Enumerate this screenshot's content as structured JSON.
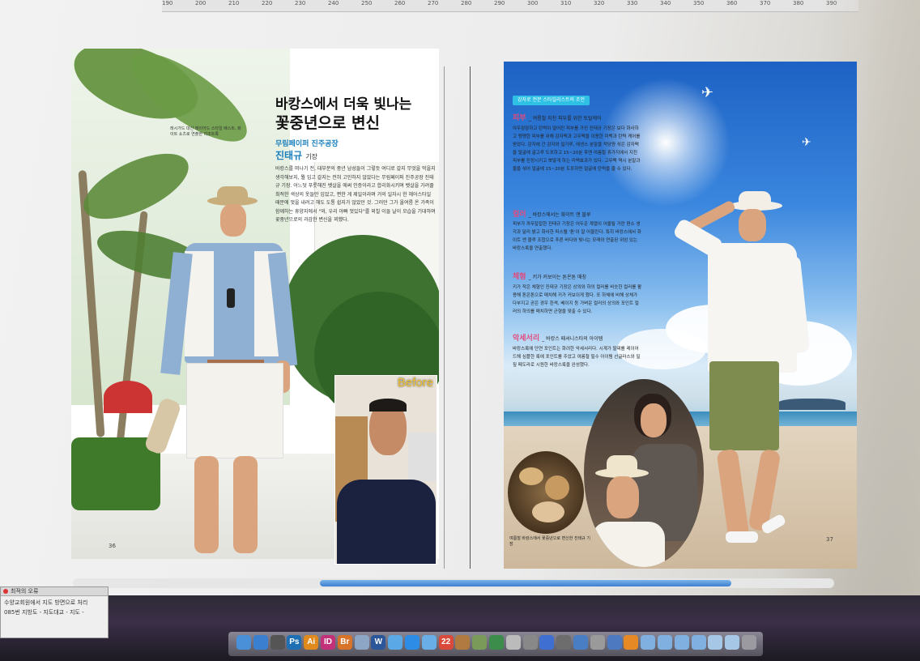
{
  "ruler": {
    "ticks": [
      "190",
      "200",
      "210",
      "220",
      "230",
      "240",
      "250",
      "260",
      "270",
      "280",
      "290",
      "300",
      "310",
      "320",
      "330",
      "340",
      "350",
      "360",
      "370",
      "380",
      "390"
    ]
  },
  "left_page": {
    "headline_line1": "바캉스에서 더욱 빛나는",
    "headline_line2": "꽃중년으로 변신",
    "byline_sub": "무림페이퍼 진주공장",
    "byline_name": "진태규",
    "byline_title": "기장",
    "body": "바캉스를 떠나기 전, 대부분의 중년 남성들이 그렇듯 여디로 갈지 무엇을 먹을지 생각해보지, 뭘 입고 갈지는 전혀 고민하지 않았다는 무림페이퍼 진주공장 진태규 기장. 어느덧 푸릇해진 뱃살을 에써 인증이라고 합리화시키며 뱃살을 가려줄 최적한 색상의 옷들만 입었고, 편한 게 제일이라며 거의 일자시 한 헤어스타일 때문에 멋을 내려고 해도 도통 쉽지가 않았던 것. 그러던 그가 올여름 온 가족이 함께하는 휴양지에서 \"와, 우리 아빠 멋있다\"를 외칠 이들 날이 모습을 기대하며 꽃중년으로의 과감한 변신을 꾀했다.",
    "caption": "래시가드 대신 레이어드 스타일 베스트, 화이트 쇼츠로 연출한 리조트룩",
    "page_number": "36",
    "before_label": "Before"
  },
  "right_page": {
    "tag": "강자로 전문 스타일리스트의 조언",
    "sections": [
      {
        "title": "피부",
        "subtitle": "_ 여름철 지친 피부를 위한 토탈케어",
        "body": "야우잠잠하고 탄력이 떨어진 피부를 가진 진태규 기장은 보다 화사하고 맹맹한 피부를 위해 감자팩과 고무팩을 이용한 미백과 탄력 케어를 받았다. 감자에 간 감자와 밀가루, 에센스 분말을 적당량 섞은 감자팩을 얼굴에 골고루 도포하고 15~20분 후엔 여름철 휴가지에서 지친 피부를 진정시키고 뽀얗게 하는 미백효과가 있다. 고무팩 역시 분말과 물을 섞어 얼굴에 15~20분 도포하면 얼굴에 탄력을 줄 수 있다."
      },
      {
        "title": "컬러",
        "subtitle": "_ 바캉스에서는 화이트 앤 블루",
        "body": "피부가 까무잡잡한 진태규 기장은 어두운 계열이 어울릴 거란 편소 생각과 달리 밝고 화사한 파스텔 '톤'이 잘 어울린다. 특히 바캉스에서 화이트 앤 블루 조합으로 푸른 바다와 빛나는 모래와 연출된 위엄 있는 바캉스룩을 연출했다."
      },
      {
        "title": "체형",
        "subtitle": "_ 키가 커보이는 톤온톤 매칭",
        "body": "키가 작은 체형인 진태규 기장은 상의와 하의 컬러를 비슷한 컬러를 활용해 톤온톤으로 매치해 키가 커보이게 했다. 또 하체에 비해 상체가 다부지고 곧은 경우 흰색, 베이지 등 가벼운 컬러의 상의와 포인트 컬러의 하의를 매치하면 균형을 맞출 수 있다."
      },
      {
        "title": "악세서리",
        "subtitle": "_ 바캉스 패셔니스타의 아이템",
        "body": "바캉스룩에 단연 포인트는 화려한 악세서리다. 시계가 팔찌를 레이어드해 심플한 룩에 포인트를 주었고 여름철 필수 아이템 선글라스와 밀짚 페도라로 시원한 바캉스룩을 완성했다."
      }
    ],
    "oval_caption": "여름철 바캉스에서 꽃중년으로 변신한 진태규 기장",
    "page_number": "37"
  },
  "bottom_panel": {
    "title": "최적의 오류",
    "rows": [
      "수양교회원에서 지도 방면으로 처리",
      "085번 지방도 - 지도대교 - 지도 -"
    ]
  },
  "dock": {
    "icons": [
      {
        "name": "finder-icon",
        "label": "",
        "color": "#4a90d9"
      },
      {
        "name": "safari-icon",
        "label": "",
        "color": "#3a7fd0"
      },
      {
        "name": "clock-icon",
        "label": "",
        "color": "#555555"
      },
      {
        "name": "photoshop-icon",
        "label": "Ps",
        "color": "#1f6fb5"
      },
      {
        "name": "illustrator-icon",
        "label": "Ai",
        "color": "#e08a1e"
      },
      {
        "name": "indesign-icon",
        "label": "ID",
        "color": "#c2307a"
      },
      {
        "name": "bridge-icon",
        "label": "Br",
        "color": "#d8732a"
      },
      {
        "name": "preview-icon",
        "label": "",
        "color": "#8ea6c6"
      },
      {
        "name": "word-icon",
        "label": "W",
        "color": "#2b579a"
      },
      {
        "name": "messages-icon",
        "label": "",
        "color": "#5aa9e6"
      },
      {
        "name": "appstore-icon",
        "label": "",
        "color": "#2d8ce6"
      },
      {
        "name": "safari2-icon",
        "label": "",
        "color": "#6aaee8"
      },
      {
        "name": "calendar-icon",
        "label": "22",
        "color": "#d94a3a"
      },
      {
        "name": "photos-icon",
        "label": "",
        "color": "#b07a40"
      },
      {
        "name": "iphoto-icon",
        "label": "",
        "color": "#7a9a5a"
      },
      {
        "name": "itunes-icon",
        "label": "",
        "color": "#3c8d4c"
      },
      {
        "name": "textedit-icon",
        "label": "",
        "color": "#bbbbbb"
      },
      {
        "name": "mail-icon",
        "label": "",
        "color": "#888888"
      },
      {
        "name": "browser-icon",
        "label": "",
        "color": "#3f6fd0"
      },
      {
        "name": "system-prefs-icon",
        "label": "",
        "color": "#6d6d6d"
      },
      {
        "name": "network-icon",
        "label": "",
        "color": "#4a7ec4"
      },
      {
        "name": "app-icon",
        "label": "",
        "color": "#9a9a9a"
      },
      {
        "name": "home-icon",
        "label": "",
        "color": "#4c79c0"
      },
      {
        "name": "vlc-icon",
        "label": "",
        "color": "#e78a25"
      },
      {
        "name": "folder-icon",
        "label": "",
        "color": "#7fb0e0"
      },
      {
        "name": "folder2-icon",
        "label": "",
        "color": "#7fb0e0"
      },
      {
        "name": "downloads-icon",
        "label": "",
        "color": "#7fb0e0"
      },
      {
        "name": "folder3-icon",
        "label": "",
        "color": "#7fb0e0"
      },
      {
        "name": "folder4-icon",
        "label": "",
        "color": "#a7c7e7"
      },
      {
        "name": "folder5-icon",
        "label": "",
        "color": "#a7c7e7"
      },
      {
        "name": "trash-icon",
        "label": "",
        "color": "#9a9aa0"
      }
    ]
  }
}
